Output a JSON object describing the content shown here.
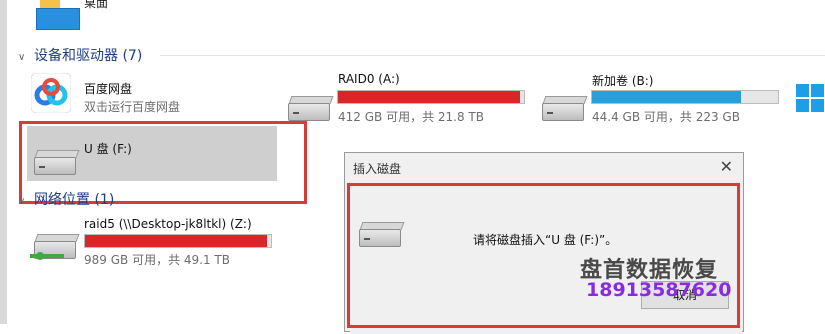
{
  "desktop_item": {
    "label": "桌面"
  },
  "groups": {
    "devices": {
      "title": "设备和驱动器 (7)"
    },
    "network": {
      "title": "网络位置 (1)"
    }
  },
  "apps": {
    "baidu": {
      "name": "百度网盘",
      "subtitle": "双击运行百度网盘"
    }
  },
  "drives": [
    {
      "name": "RAID0 (A:)",
      "info": "412 GB 可用，共 21.8 TB",
      "fill": 0.98,
      "color": "#da2626"
    },
    {
      "name": "新加卷 (B:)",
      "info": "44.4 GB 可用，共 223 GB",
      "fill": 0.8,
      "color": "#26a0da"
    }
  ],
  "usb": {
    "name": "U 盘 (F:)"
  },
  "network_drive": {
    "name": "raid5 (\\\\Desktop-jk8ltkl) (Z:)",
    "info": "989 GB 可用，共 49.1 TB",
    "fill": 0.98,
    "color": "#da2626"
  },
  "dialog": {
    "title": "插入磁盘",
    "close": "✕",
    "message": "请将磁盘插入“U 盘 (F:)”。",
    "button": "取消"
  },
  "watermark": {
    "title": "盘首数据恢复",
    "phone": "18913587620"
  }
}
